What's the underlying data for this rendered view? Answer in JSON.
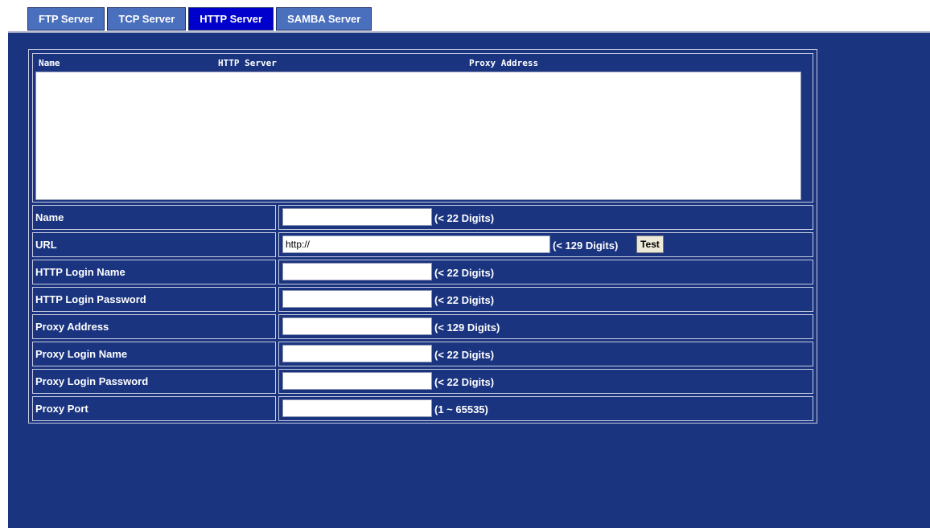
{
  "tabs": [
    {
      "label": "FTP Server",
      "active": false
    },
    {
      "label": "TCP Server",
      "active": false
    },
    {
      "label": "HTTP Server",
      "active": true
    },
    {
      "label": "SAMBA Server",
      "active": false
    }
  ],
  "list": {
    "columns": [
      "Name",
      "HTTP Server",
      "Proxy Address"
    ],
    "items": []
  },
  "form": {
    "rows": [
      {
        "label": "Name",
        "value": "",
        "hint": "(< 22 Digits)"
      },
      {
        "label": "URL",
        "value": "http://",
        "hint": "(< 129 Digits)",
        "button": "Test"
      },
      {
        "label": "HTTP Login Name",
        "value": "",
        "hint": "(< 22 Digits)"
      },
      {
        "label": "HTTP Login Password",
        "value": "",
        "hint": "(< 22 Digits)"
      },
      {
        "label": "Proxy Address",
        "value": "",
        "hint": "(< 129 Digits)"
      },
      {
        "label": "Proxy Login Name",
        "value": "",
        "hint": "(< 22 Digits)"
      },
      {
        "label": "Proxy Login Password",
        "value": "",
        "hint": "(< 22 Digits)"
      },
      {
        "label": "Proxy Port",
        "value": "",
        "hint": "(1 ~ 65535)"
      }
    ]
  },
  "colors": {
    "panel_bg": "#1a3480",
    "tab_bg": "#4a6fbd",
    "tab_active_bg": "#0000cc",
    "border": "#c8cde0"
  }
}
